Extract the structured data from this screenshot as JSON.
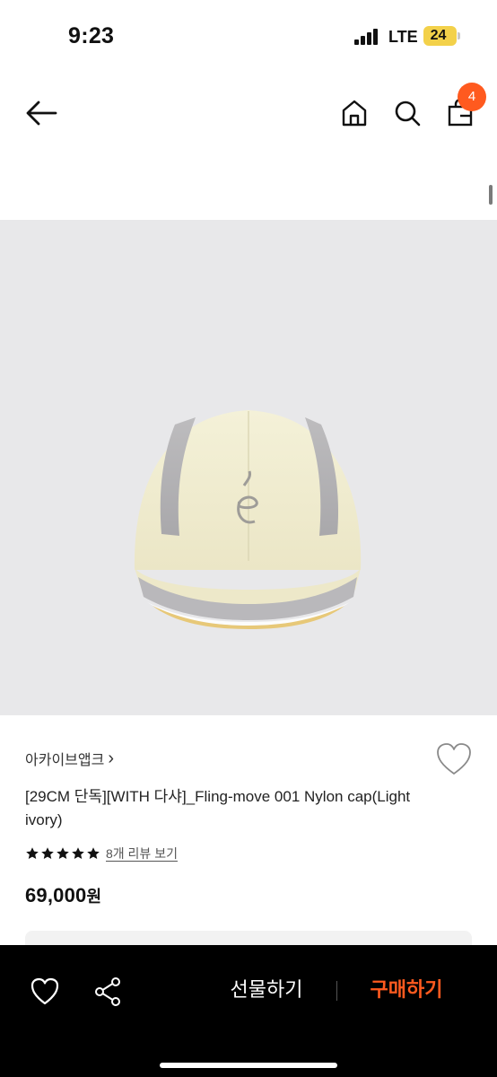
{
  "status_bar": {
    "time": "9:23",
    "network": "LTE",
    "battery": "24"
  },
  "nav": {
    "cart_count": "4"
  },
  "product": {
    "brand": "아카이브앱크",
    "brand_chevron": "›",
    "title": "[29CM 단독][WITH 다샤]_Fling-move 001 Nylon cap(Light ivory)",
    "rating_stars": 5,
    "review_text": "8개 리뷰 보기",
    "price": "69,000",
    "price_unit": "원"
  },
  "bottom_bar": {
    "gift_label": "선물하기",
    "buy_label": "구매하기"
  },
  "colors": {
    "accent": "#ff5a1f",
    "image_bg": "#e8e8ea",
    "bottom_bar": "#000000"
  },
  "icons": [
    "back-arrow-icon",
    "home-icon",
    "search-icon",
    "shopping-bag-icon",
    "heart-outline-icon",
    "share-icon",
    "star-icon"
  ]
}
